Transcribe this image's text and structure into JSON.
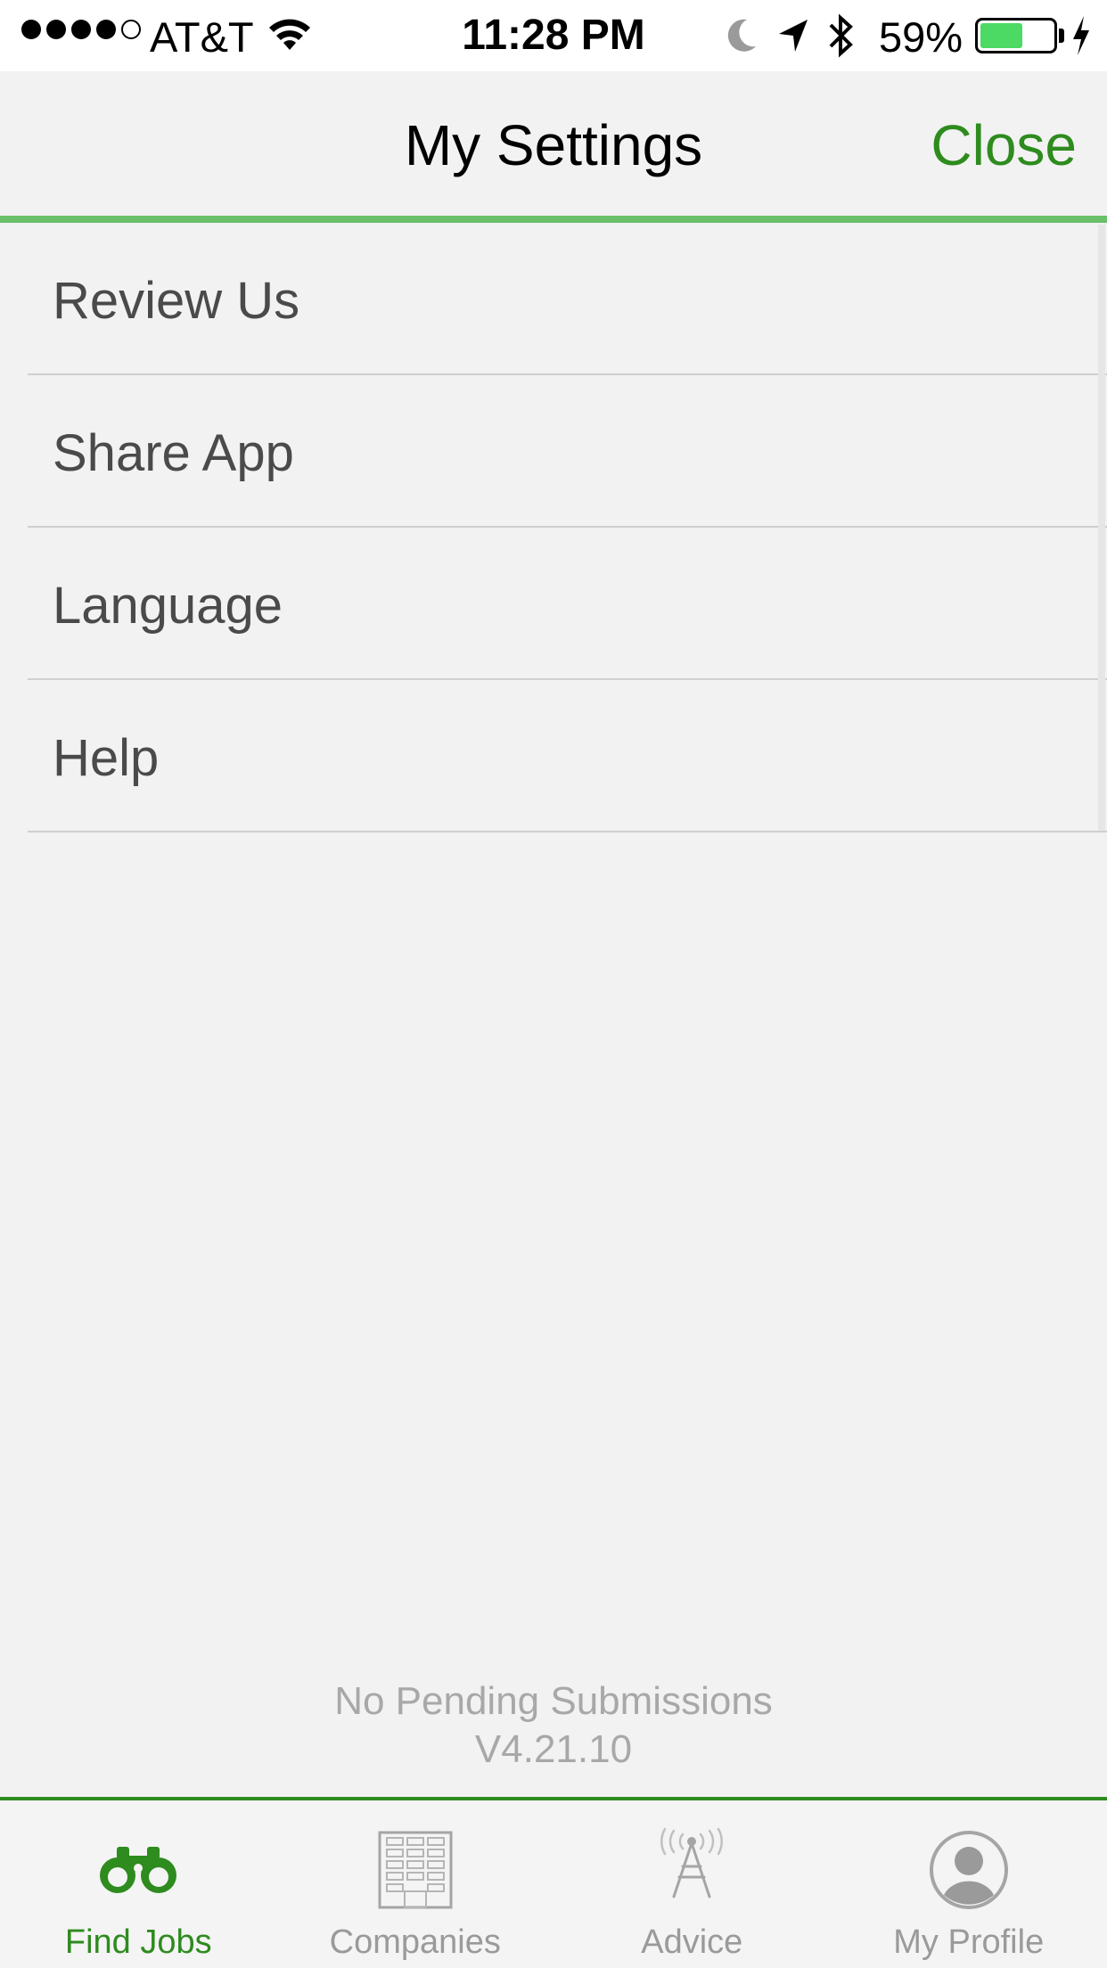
{
  "status_bar": {
    "carrier": "AT&T",
    "time": "11:28 PM",
    "battery_percent": "59%",
    "battery_level": 0.59,
    "battery_color": "#4cd964"
  },
  "header": {
    "title": "My Settings",
    "close_label": "Close",
    "accent_color": "#2e8b1e"
  },
  "menu": {
    "items": [
      {
        "label": "Review Us"
      },
      {
        "label": "Share App"
      },
      {
        "label": "Language"
      },
      {
        "label": "Help"
      }
    ]
  },
  "footer": {
    "status": "No Pending Submissions",
    "version": "V4.21.10"
  },
  "tabs": [
    {
      "label": "Find Jobs",
      "icon": "binoculars-icon",
      "active": true
    },
    {
      "label": "Companies",
      "icon": "building-icon",
      "active": false
    },
    {
      "label": "Advice",
      "icon": "broadcast-tower-icon",
      "active": false
    },
    {
      "label": "My Profile",
      "icon": "user-avatar-icon",
      "active": false
    }
  ]
}
